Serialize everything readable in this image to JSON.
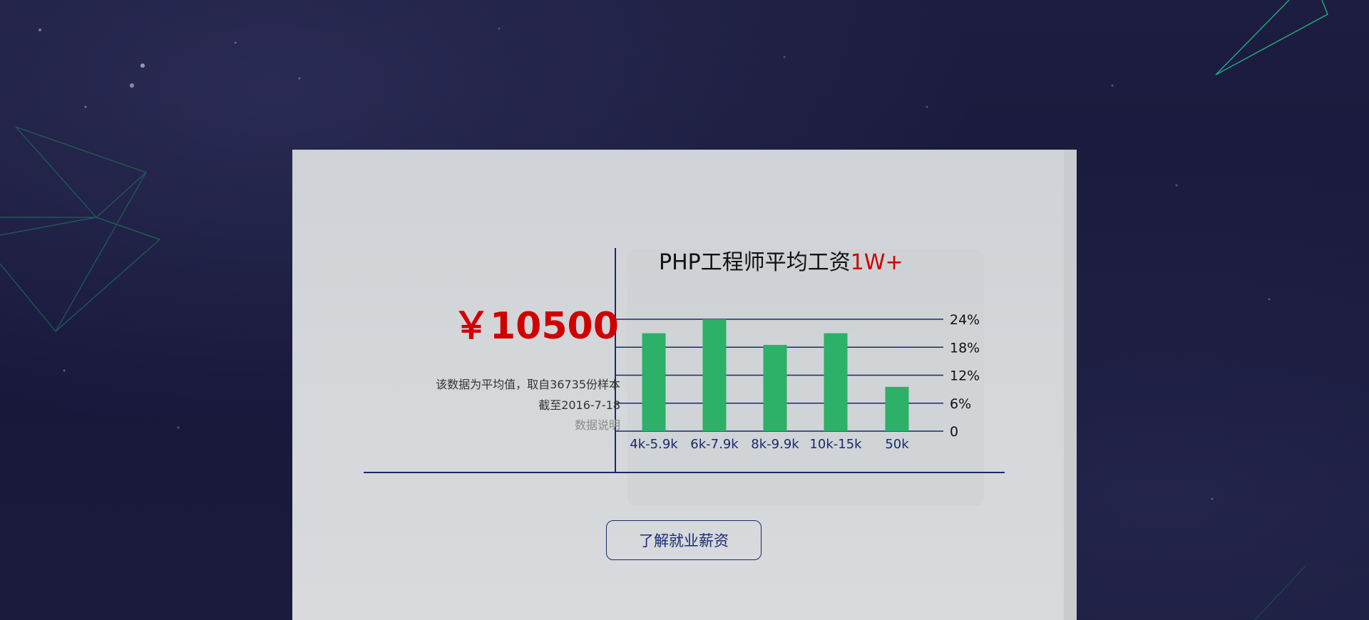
{
  "card": {
    "price": "￥10500",
    "note_sample": "该数据为平均值，取自36735份样本",
    "note_date": "截至2016-7-18",
    "note_link": "数据说明",
    "button_label": "了解就业薪资"
  },
  "chart_data": {
    "type": "bar",
    "title": "PHP工程师平均工资",
    "title_accent": "1W+",
    "categories": [
      "4k-5.9k",
      "6k-7.9k",
      "8k-9.9k",
      "10k-15k",
      "50k"
    ],
    "values": [
      21,
      24,
      18.5,
      21,
      9.5
    ],
    "y_ticks": [
      "0",
      "6%",
      "12%",
      "18%",
      "24%"
    ],
    "ylim": [
      0,
      24
    ],
    "bar_color": "#2db068",
    "axis_color": "#1a2a6b",
    "grid": true
  },
  "colors": {
    "background": "#1a1b3b",
    "card": "#d4d7da",
    "price": "#d10000",
    "accent_line": "#1fae7f"
  }
}
